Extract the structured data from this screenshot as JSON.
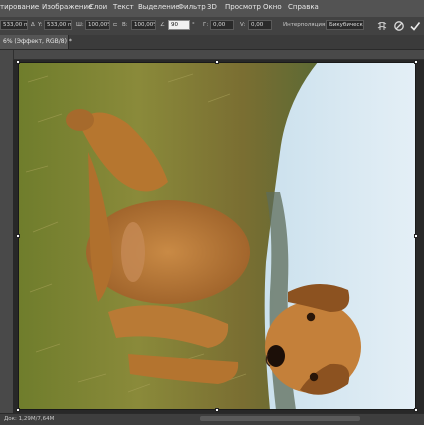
{
  "menu": {
    "items": [
      "тирование",
      "Изображение",
      "Слои",
      "Текст",
      "Выделение",
      "Фильтр",
      "3D",
      "Просмотр",
      "Окно",
      "Справка"
    ]
  },
  "options": {
    "x_value": "533,00 пи",
    "y_value": "533,00 пи",
    "w_value": "100,00%",
    "h_value": "100,00%",
    "angle_value": "90",
    "hskew_label": "Г:",
    "hskew_value": "0,00",
    "vskew_label": "V:",
    "vskew_value": "0,00",
    "interp_label": "Интерполяция:",
    "interp_value": "Бикубическая"
  },
  "document": {
    "tab_title": "6% (Эффект, RGB/8) *"
  },
  "status": {
    "doc_info": "Док: 1,29М/7,64М"
  },
  "colors": {
    "accent": "#f0f0f0",
    "panel": "#535353",
    "options_bar": "#424242",
    "canvas_bg": "#282828"
  }
}
